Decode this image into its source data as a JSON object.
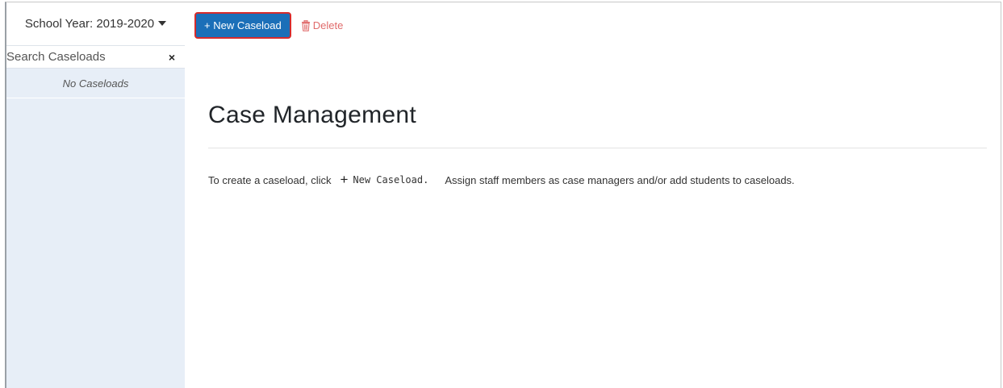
{
  "sidebar": {
    "school_year_label": "School Year: 2019-2020",
    "search_placeholder": "Search Caseloads",
    "clear_label": "×",
    "empty_label": "No Caseloads"
  },
  "toolbar": {
    "new_caseload_label": "+ New Caseload",
    "delete_label": "Delete"
  },
  "main": {
    "title": "Case Management",
    "instructions_before": "To create a caseload, click",
    "plus_symbol": "+",
    "instructions_code": "New Caseload.",
    "instructions_after": "Assign staff members as case managers and/or add students to caseloads."
  },
  "colors": {
    "primary": "#1b6fb8",
    "highlight_border": "#d62b2b",
    "delete": "#e06b6b",
    "sidebar_bg": "#e7eef7"
  }
}
